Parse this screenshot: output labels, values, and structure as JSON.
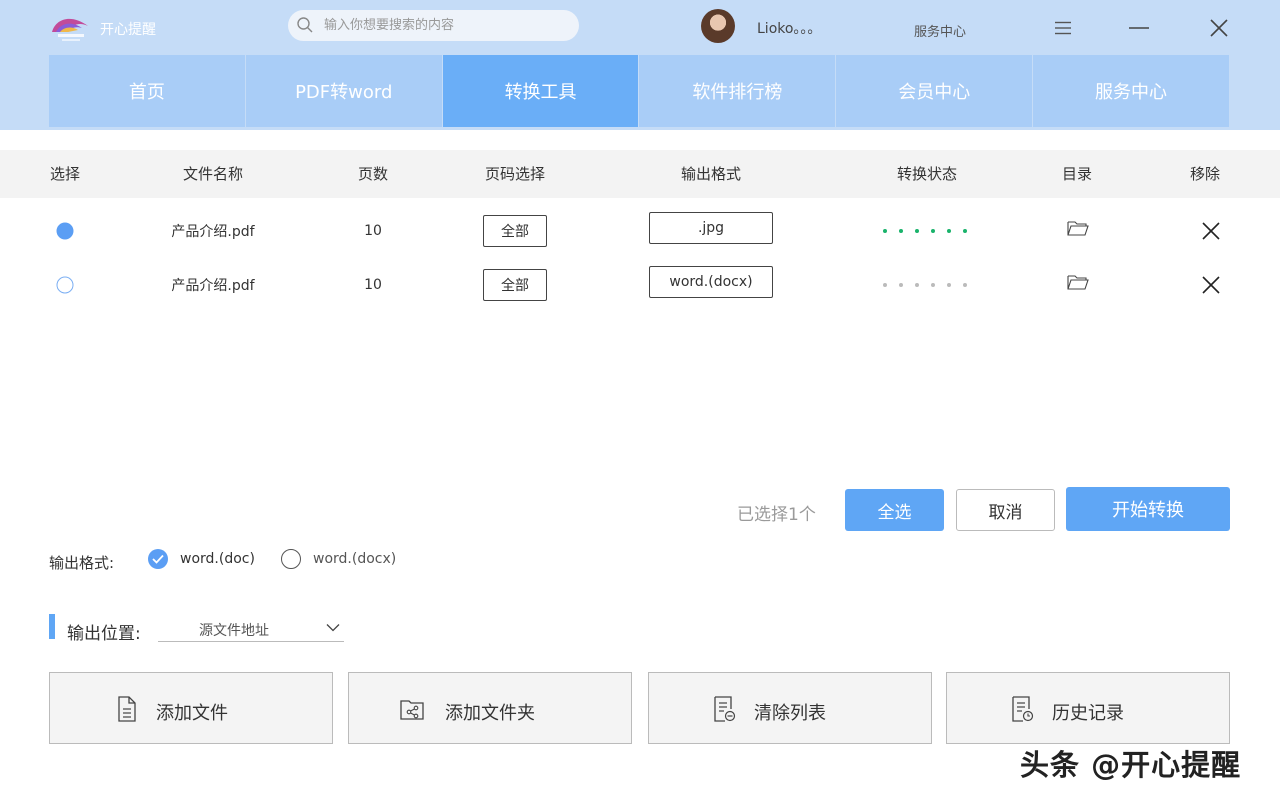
{
  "header": {
    "app_name": "开心提醒",
    "search_placeholder": "输入你想要搜索的内容",
    "username": "Lioko。。。",
    "service_center": "服务中心"
  },
  "nav": {
    "tabs": [
      {
        "label": "首页"
      },
      {
        "label": "PDF转word"
      },
      {
        "label": "转换工具",
        "active": true
      },
      {
        "label": "软件排行榜"
      },
      {
        "label": "会员中心"
      },
      {
        "label": "服务中心"
      }
    ]
  },
  "table": {
    "columns": [
      "选择",
      "文件名称",
      "页数",
      "页码选择",
      "输出格式",
      "转换状态",
      "目录",
      "移除"
    ],
    "rows": [
      {
        "selected": true,
        "filename": "产品介绍.pdf",
        "pages": "10",
        "page_range": "全部",
        "format": ".jpg",
        "status_color": "#19b36b"
      },
      {
        "selected": false,
        "filename": "产品介绍.pdf",
        "pages": "10",
        "page_range": "全部",
        "format": "word.(docx)",
        "status_color": "#bbbbbb"
      }
    ]
  },
  "actions": {
    "selected_count": "已选择1个",
    "select_all": "全选",
    "cancel": "取消",
    "start": "开始转换"
  },
  "output_format": {
    "label": "输出格式:",
    "options": [
      {
        "label": "word.(doc)",
        "checked": true
      },
      {
        "label": "word.(docx)",
        "checked": false
      }
    ]
  },
  "output_location": {
    "label": "输出位置:",
    "value": "源文件地址"
  },
  "tools": {
    "add_file": "添加文件",
    "add_folder": "添加文件夹",
    "clear_list": "清除列表",
    "history": "历史记录"
  },
  "watermark": "头条 @开心提醒",
  "colors": {
    "header_bg": "#c5dcf7",
    "nav_tab": "#a9cdf7",
    "nav_active": "#6aaef7",
    "accent": "#5fa6f5",
    "status_done": "#19b36b"
  }
}
